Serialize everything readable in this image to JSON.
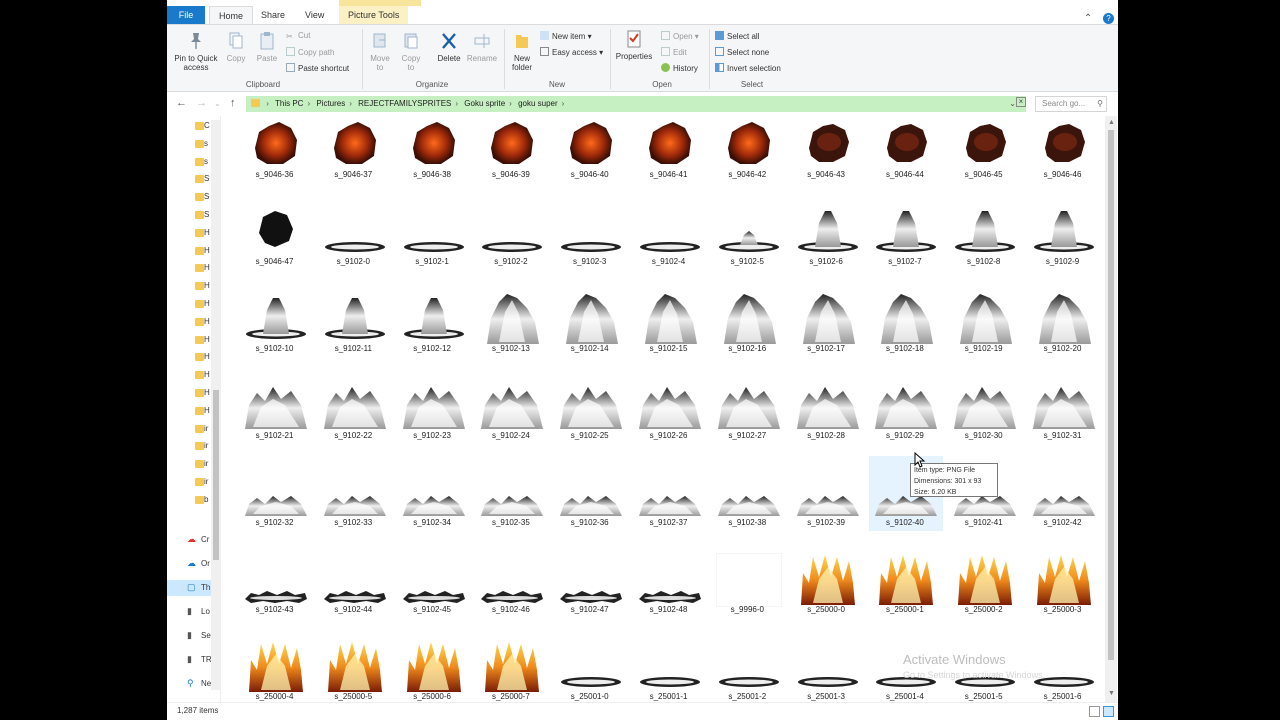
{
  "window": {
    "title": "goku super",
    "ribbon_tabs": [
      "File",
      "Home",
      "Share",
      "View",
      "Picture Tools"
    ]
  },
  "ribbon": {
    "clipboard": {
      "pin": "Pin to Quick access",
      "copy": "Copy",
      "paste": "Paste",
      "cut": "Cut",
      "copy_path": "Copy path",
      "paste_shortcut": "Paste shortcut",
      "group": "Clipboard"
    },
    "organize": {
      "move_to": "Move to",
      "copy_to": "Copy to",
      "delete": "Delete",
      "rename": "Rename",
      "group": "Organize"
    },
    "new": {
      "new_folder": "New folder",
      "new_item": "New item",
      "easy_access": "Easy access",
      "group": "New"
    },
    "open": {
      "properties": "Properties",
      "open": "Open",
      "edit": "Edit",
      "history": "History",
      "group": "Open"
    },
    "select": {
      "select_all": "Select all",
      "select_none": "Select none",
      "invert": "Invert selection",
      "group": "Select"
    }
  },
  "address": {
    "path": [
      "This PC",
      "Pictures",
      "REJECTFAMILYSPRITES",
      "Goku sprite",
      "goku super"
    ],
    "search_placeholder": "Search go..."
  },
  "nav_pane": {
    "folders": [
      "C",
      "s",
      "s",
      "S",
      "S",
      "S",
      "H",
      "H",
      "H",
      "H",
      "H",
      "H",
      "H",
      "H",
      "H",
      "H",
      "H",
      "ir",
      "ir",
      "ir",
      "ir",
      "b"
    ],
    "items": [
      {
        "label": "Cr",
        "icon": "creative-cloud-icon"
      },
      {
        "label": "Or",
        "icon": "onedrive-icon"
      },
      {
        "label": "Th",
        "icon": "this-pc-icon"
      },
      {
        "label": "Lo",
        "icon": "drive-icon"
      },
      {
        "label": "Se",
        "icon": "drive-icon"
      },
      {
        "label": "TR",
        "icon": "drive-icon"
      },
      {
        "label": "Ne",
        "icon": "network-icon"
      }
    ]
  },
  "files": {
    "rows": [
      [
        "s_9046-36",
        "s_9046-37",
        "s_9046-38",
        "s_9046-39",
        "s_9046-40",
        "s_9046-41",
        "s_9046-42",
        "s_9046-43",
        "s_9046-44",
        "s_9046-45",
        "s_9046-46"
      ],
      [
        "s_9046-47",
        "s_9102-0",
        "s_9102-1",
        "s_9102-2",
        "s_9102-3",
        "s_9102-4",
        "s_9102-5",
        "s_9102-6",
        "s_9102-7",
        "s_9102-8",
        "s_9102-9"
      ],
      [
        "s_9102-10",
        "s_9102-11",
        "s_9102-12",
        "s_9102-13",
        "s_9102-14",
        "s_9102-15",
        "s_9102-16",
        "s_9102-17",
        "s_9102-18",
        "s_9102-19",
        "s_9102-20"
      ],
      [
        "s_9102-21",
        "s_9102-22",
        "s_9102-23",
        "s_9102-24",
        "s_9102-25",
        "s_9102-26",
        "s_9102-27",
        "s_9102-28",
        "s_9102-29",
        "s_9102-30",
        "s_9102-31"
      ],
      [
        "s_9102-32",
        "s_9102-33",
        "s_9102-34",
        "s_9102-35",
        "s_9102-36",
        "s_9102-37",
        "s_9102-38",
        "s_9102-39",
        "s_9102-40",
        "s_9102-41",
        "s_9102-42"
      ],
      [
        "s_9102-43",
        "s_9102-44",
        "s_9102-45",
        "s_9102-46",
        "s_9102-47",
        "s_9102-48",
        "s_9996-0",
        "s_25000-0",
        "s_25000-1",
        "s_25000-2",
        "s_25000-3"
      ],
      [
        "s_25000-4",
        "s_25000-5",
        "s_25000-6",
        "s_25000-7",
        "s_25001-0",
        "s_25001-1",
        "s_25001-2",
        "s_25001-3",
        "s_25001-4",
        "s_25001-5",
        "s_25001-6"
      ]
    ],
    "kinds": [
      [
        "blast",
        "blast",
        "blast",
        "blast",
        "blast",
        "blast",
        "blast",
        "dark",
        "dark",
        "dark",
        "dark"
      ],
      [
        "darkblob",
        "ring",
        "ring",
        "ring",
        "ring",
        "ring",
        "smallburst",
        "burst",
        "burst",
        "burst",
        "burst"
      ],
      [
        "burst",
        "burst",
        "burst",
        "tall",
        "tall",
        "tall",
        "tall",
        "tall",
        "tall",
        "tall",
        "tall"
      ],
      [
        "wide",
        "wide",
        "wide",
        "wide",
        "wide",
        "wide",
        "wide",
        "wide",
        "wide",
        "wide",
        "wide"
      ],
      [
        "low",
        "low",
        "low",
        "low",
        "low",
        "low",
        "low",
        "low",
        "low",
        "low",
        "low"
      ],
      [
        "debris",
        "debris",
        "debris",
        "debris",
        "debris",
        "debris",
        "blank",
        "fire",
        "fire",
        "fire",
        "fire"
      ],
      [
        "fire",
        "fire",
        "fire",
        "fire",
        "ring",
        "ring",
        "ring",
        "ring",
        "ring",
        "ring",
        "ring"
      ]
    ]
  },
  "tooltip": {
    "type": "Item type: PNG File",
    "dimensions": "Dimensions: 301 x 93",
    "size": "Size: 6.20 KB"
  },
  "watermark": "Activate Windows",
  "watermark_sub": "Go to Settings to activate Windows.",
  "status": {
    "count": "1,287 items"
  }
}
